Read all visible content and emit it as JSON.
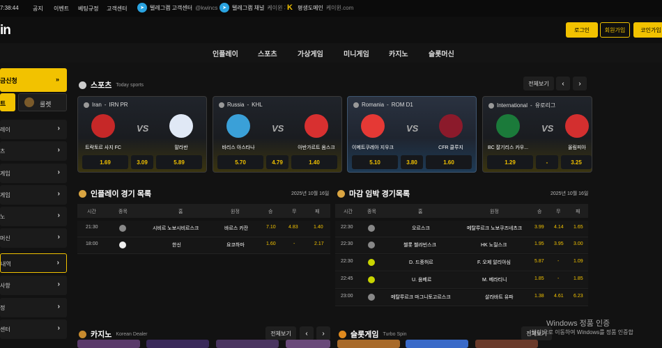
{
  "topbar": {
    "clock": "7:38:44",
    "links": [
      "공지",
      "이벤트",
      "베팅규정",
      "고객센터"
    ],
    "telegram_cs": {
      "label": "텔레그램 고객센터",
      "sub": "@kwincs"
    },
    "telegram_ch": {
      "label": "텔레그램 채널",
      "sub": "케이윈 채널"
    },
    "domain": {
      "label": "평생도메인",
      "sub": "케이윈.com"
    }
  },
  "header": {
    "logo": "in",
    "login": "로그인",
    "join": "회원가입",
    "coin": "코인가입"
  },
  "nav": [
    "인플레이",
    "스포츠",
    "가상게임",
    "미니게임",
    "카지노",
    "슬롯머신"
  ],
  "sidebar": {
    "promo": "금신청",
    "promo_arrow": "»",
    "tab1": "트",
    "tab2": "룰렛",
    "items": [
      {
        "label": "레이",
        "arrow": "›"
      },
      {
        "label": "츠",
        "arrow": "›"
      },
      {
        "label": "게임",
        "arrow": "›"
      },
      {
        "label": "게임",
        "arrow": "›"
      },
      {
        "label": "노",
        "arrow": "›"
      },
      {
        "label": "머신",
        "arrow": "›"
      },
      {
        "label": "내역",
        "arrow": "›",
        "active": true
      },
      {
        "label": "사항",
        "arrow": "›"
      },
      {
        "label": "정",
        "arrow": "›"
      },
      {
        "label": "센터",
        "arrow": "›"
      }
    ]
  },
  "sports": {
    "title": "스포츠",
    "sub": "Today sports",
    "all": "전체보기",
    "cards": [
      {
        "country": "Iran",
        "league": "IRN PR",
        "home": "트락토르 사지 FC",
        "away": "말라반",
        "odds": [
          "1.69",
          "3.09",
          "5.89"
        ],
        "home_color": "#c62828",
        "away_color": "#e0e8f5"
      },
      {
        "country": "Russia",
        "league": "KHL",
        "home": "바리스 아스타나",
        "away": "아반가르트 옴스크",
        "odds": [
          "5.70",
          "4.79",
          "1.40"
        ],
        "home_color": "#3aa0d8",
        "away_color": "#d83030"
      },
      {
        "country": "Romania",
        "league": "ROM D1",
        "home": "이메트쿠레아 지우크",
        "away": "CFR 클루지",
        "odds": [
          "5.10",
          "3.80",
          "1.60"
        ],
        "home_color": "#e53935",
        "away_color": "#8b1a2b"
      },
      {
        "country": "International",
        "league": "유로리그",
        "home": "BC 잘기리스 카우...",
        "away": "올림피아",
        "odds": [
          "1.29",
          "-",
          "3.25"
        ],
        "home_color": "#1b7a3a",
        "away_color": "#d32f2f"
      }
    ],
    "vs": "VS"
  },
  "inplay": {
    "title": "인플레이 경기 목록",
    "date": "2025년 10월 16일",
    "headers": [
      "시간",
      "종목",
      "홈",
      "원정",
      "승",
      "무",
      "패"
    ],
    "rows": [
      {
        "time": "21:30",
        "sport": "hockey",
        "home": "시비르 노보시비르스크",
        "away": "바르스 카잔",
        "w": "7.10",
        "d": "4.83",
        "l": "1.40"
      },
      {
        "time": "18:00",
        "sport": "baseball",
        "home": "한신",
        "away": "요코하마",
        "w": "1.60",
        "d": "-",
        "l": "2.17"
      }
    ]
  },
  "closing": {
    "title": "마감 임박 경기목록",
    "date": "2025년 10월 16일",
    "headers": [
      "시간",
      "종목",
      "홈",
      "원정",
      "승",
      "무",
      "패"
    ],
    "rows": [
      {
        "time": "22:30",
        "sport": "hockey",
        "home": "오르스크",
        "away": "메탈루르크 노보쿠즈네츠크",
        "w": "3.99",
        "d": "4.14",
        "l": "1.65"
      },
      {
        "time": "22:30",
        "sport": "hockey",
        "home": "첼롯 첼랴빈스크",
        "away": "HK 노릴스크",
        "w": "1.95",
        "d": "3.95",
        "l": "3.00"
      },
      {
        "time": "22:30",
        "sport": "tennis",
        "home": "D. 드종허르",
        "away": "F. 오제 알리아심",
        "w": "5.87",
        "d": "-",
        "l": "1.09"
      },
      {
        "time": "22:45",
        "sport": "tennis",
        "home": "U. 움베르",
        "away": "M. 베라티니",
        "w": "1.85",
        "d": "-",
        "l": "1.85"
      },
      {
        "time": "23:00",
        "sport": "hockey",
        "home": "메탈루르크 마그니토고르스크",
        "away": "살라바트 유파",
        "w": "1.38",
        "d": "4.61",
        "l": "6.23"
      }
    ]
  },
  "casino": {
    "title": "카지노",
    "sub": "Korean Dealer",
    "all": "전체보기"
  },
  "slot": {
    "title": "슬롯게임",
    "sub": "Turbo Spin",
    "all": "전체보기"
  },
  "watermark": {
    "line1": "Windows 정품 인증",
    "line2": "[설정]으로 이동하여 Windows를 정품 인증합"
  },
  "colors": {
    "accent": "#f2c200",
    "bg": "#121212"
  }
}
